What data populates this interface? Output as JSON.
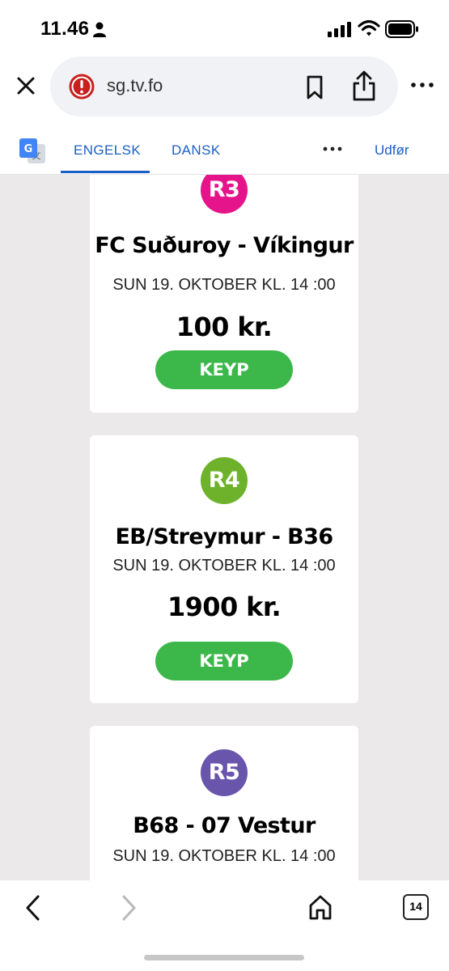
{
  "status_bar": {
    "time": "11.46",
    "icons": [
      "person-icon",
      "signal-icon",
      "wifi-icon",
      "battery-icon"
    ]
  },
  "browser": {
    "url": "sg.tv.fo",
    "icons": [
      "close-icon",
      "site-warning-icon",
      "bookmark-icon",
      "share-icon",
      "more-icon"
    ]
  },
  "translate_bar": {
    "tabs": [
      {
        "label": "ENGELSK",
        "active": true
      },
      {
        "label": "DANSK",
        "active": false
      }
    ],
    "action_label": "Udfør",
    "accent_color": "#1a5fc4"
  },
  "matches": [
    {
      "round": "R3",
      "badge_color": "#e5148a",
      "title": "FC Suðuroy - Víkingur",
      "date": "SUN 19. OKTOBER KL. 14 :00",
      "price": "100 kr.",
      "button": "KEYP"
    },
    {
      "round": "R4",
      "badge_color": "#6db22a",
      "title": "EB/Streymur - B36",
      "date": "SUN 19. OKTOBER KL. 14 :00",
      "price": "1900 kr.",
      "button": "KEYP"
    },
    {
      "round": "R5",
      "badge_color": "#6a55ad",
      "title": "B68 - 07 Vestur",
      "date": "SUN 19. OKTOBER KL. 14 :00"
    }
  ],
  "colors": {
    "buy_button": "#3cb84a",
    "page_background": "#ebe9ea"
  },
  "toolbar": {
    "tab_count": "14",
    "icons": [
      "back-icon",
      "forward-icon",
      "home-icon",
      "tabs-icon"
    ]
  }
}
